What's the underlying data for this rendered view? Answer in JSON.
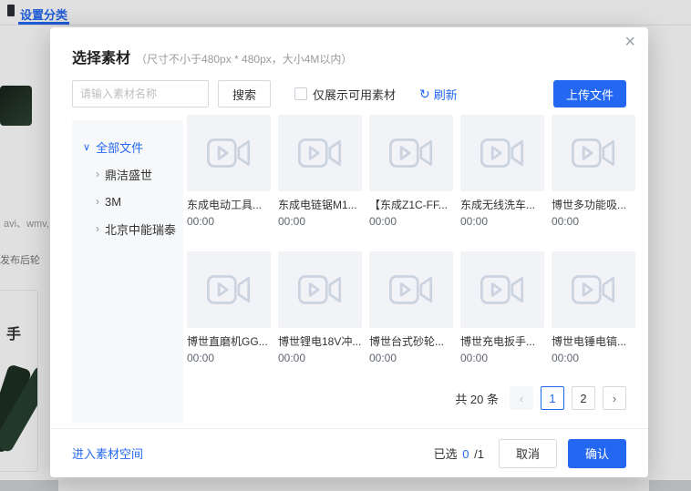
{
  "colors": {
    "primary": "#2468F2"
  },
  "background": {
    "tab": "设置分类",
    "formats_text": "avi、wmv,",
    "publish_text": "发布后轮",
    "card_char": "手"
  },
  "modal": {
    "title": "选择素材",
    "subtitle": "（尺寸不小于480px * 480px，大小4M以内）",
    "close_icon": "×",
    "toolbar": {
      "search_placeholder": "请输入素材名称",
      "search_button": "搜索",
      "checkbox_label": "仅展示可用素材",
      "refresh_icon": "↻",
      "refresh_label": "刷新",
      "upload_button": "上传文件"
    },
    "tree": {
      "root_caret": "∨",
      "child_caret": "›",
      "root": "全部文件",
      "children": [
        "鼎洁盛世",
        "3M",
        "北京中能瑞泰"
      ]
    },
    "items": [
      {
        "title": "东成电动工具...",
        "duration": "00:00"
      },
      {
        "title": "东成电链锯M1...",
        "duration": "00:00"
      },
      {
        "title": "【东成Z1C-FF...",
        "duration": "00:00"
      },
      {
        "title": "东成无线洗车...",
        "duration": "00:00"
      },
      {
        "title": "博世多功能吸...",
        "duration": "00:00"
      },
      {
        "title": "博世直磨机GG...",
        "duration": "00:00"
      },
      {
        "title": "博世锂电18V冲...",
        "duration": "00:00"
      },
      {
        "title": "博世台式砂轮...",
        "duration": "00:00"
      },
      {
        "title": "博世充电扳手...",
        "duration": "00:00"
      },
      {
        "title": "博世电锤电镐...",
        "duration": "00:00"
      }
    ],
    "pagination": {
      "total": "共 20 条",
      "prev": "‹",
      "pages": [
        "1",
        "2"
      ],
      "next": "›"
    },
    "footer": {
      "space_link": "进入素材空间",
      "selected_label": "已选",
      "selected_count": "0",
      "selected_total": "/1",
      "cancel": "取消",
      "confirm": "确认"
    }
  }
}
